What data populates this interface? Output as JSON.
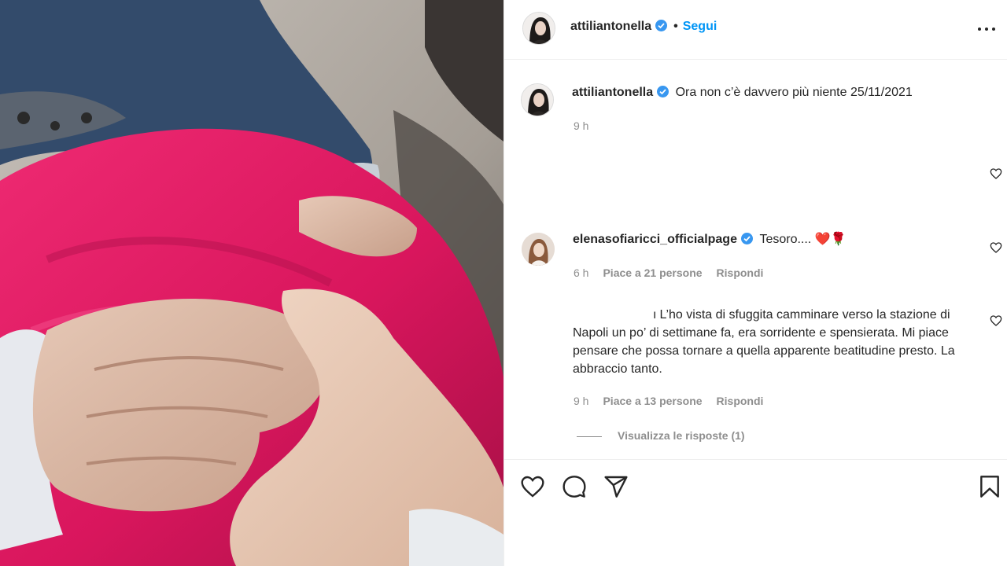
{
  "post": {
    "author": "attiliantonella",
    "follow_label": "Segui",
    "more_icon": "more-horizontal-icon"
  },
  "caption": {
    "username": "attiliantonella",
    "text": "Ora non c’è davvero più niente 25/11/2021",
    "time": "9 h"
  },
  "comments": [
    {
      "username": "elenasofiaricci_officialpage",
      "text": "Tesoro.... ",
      "emoji": "❤️🌹",
      "time": "6 h",
      "likes": "Piace a 21 persone",
      "reply_label": "Rispondi"
    },
    {
      "lead_char": "ı",
      "text": "L’ho vista di sfuggita camminare verso la stazione di Napoli un po’ di settimane fa, era sorridente e spensierata. Mi piace pensare che possa tornare a quella apparente beatitudine presto. La abbraccio tanto.",
      "time": "9 h",
      "likes": "Piace a 13 persone",
      "reply_label": "Rispondi",
      "view_replies": "Visualizza le risposte (1)"
    }
  ],
  "actions": {
    "icons": [
      "heart-icon",
      "comment-icon",
      "share-icon",
      "bookmark-icon"
    ]
  },
  "colors": {
    "accent": "#0095f6",
    "verified": "#3897f0",
    "muted": "#8e8e8e",
    "text": "#262626",
    "blanket": "#e0185f"
  }
}
